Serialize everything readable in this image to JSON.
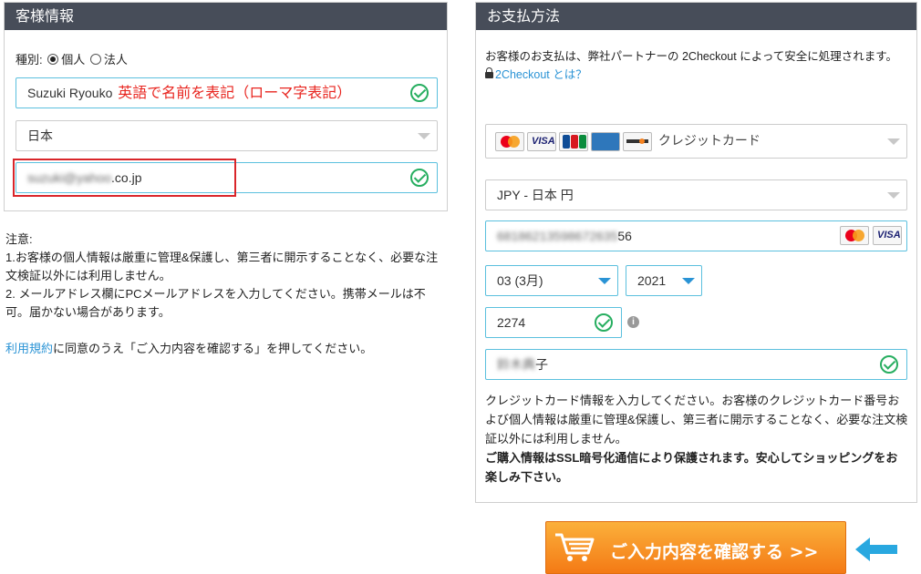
{
  "customer": {
    "title": "客様情報",
    "type_label": "種別:",
    "type_options": [
      "個人",
      "法人"
    ],
    "name_value": "Suzuki Ryouko",
    "name_hint": "英語で名前を表記（ローマ字表記）",
    "country_value": "日本",
    "email_user_masked": "suzuki@yahoo",
    "email_domain": ".co.jp"
  },
  "notes": {
    "heading": "注意:",
    "line1": "1.お客様の個人情報は厳重に管理&保護し、第三者に開示することなく、必要な注文検証以外には利用しません。",
    "line2": "2. メールアドレス欄にPCメールアドレスを入力してください。携帯メールは不可。届かない場合があります。",
    "terms_link": "利用規約",
    "terms_text": "に同意のうえ「ご入力内容を確認する」を押してください。"
  },
  "payment": {
    "title": "お支払方法",
    "intro": "お客様のお支払は、弊社パートナーの 2Checkout によって安全に処理されます。",
    "about_link": "2Checkout とは？",
    "method_label": "クレジットカード",
    "card_logos": [
      "mastercard",
      "visa",
      "jcb",
      "american-express",
      "discover"
    ],
    "currency_value": "JPY - 日本 円",
    "card_number_masked": "68186213598672635",
    "card_number_tail": "56",
    "expiry_month": "03 (3月)",
    "expiry_year": "2021",
    "cvv_value": "2274",
    "holder_masked": "鈴木典",
    "holder_tail": "子",
    "info_glyph": "i",
    "description": "クレジットカード情報を入力してください。お客様のクレジットカード番号および個人情報は厳重に管理&保護し、第三者に開示することなく、必要な注文検証以外には利用しません。",
    "ssl_note": "ご購入情報はSSL暗号化通信により保護されます。安心してショッピングをお楽しみ下さい。"
  },
  "confirm": {
    "label": "ご入力内容を確認する >>"
  },
  "colors": {
    "header_bg": "#474d59",
    "accent_blue": "#2a93d5",
    "valid_green": "#27ae60",
    "hint_red": "#e8251f",
    "button_orange": "#f68c1f"
  }
}
